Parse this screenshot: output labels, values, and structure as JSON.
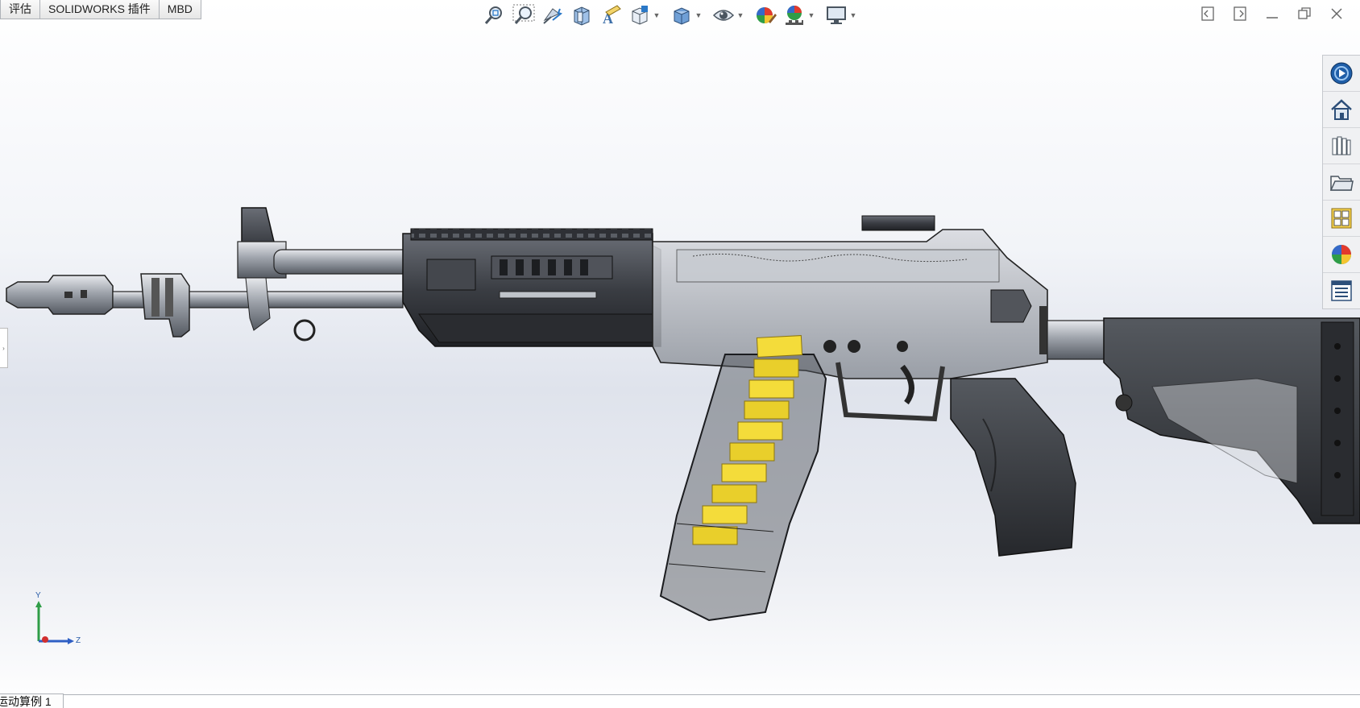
{
  "tabs": [
    {
      "label": "评估"
    },
    {
      "label": "SOLIDWORKS 插件"
    },
    {
      "label": "MBD"
    }
  ],
  "hud_icons": [
    "zoom-to-fit-icon",
    "zoom-to-area-icon",
    "previous-view-icon",
    "section-view-icon",
    "dynamic-annotation-icon",
    "view-orientation-icon",
    "display-style-icon",
    "hide-show-items-icon",
    "edit-appearance-icon",
    "apply-scene-icon",
    "view-settings-icon"
  ],
  "taskpane_icons": [
    "solidworks-resources-icon",
    "design-library-icon",
    "file-explorer-icon",
    "folder-icon",
    "view-palette-icon",
    "appearances-scenes-icon",
    "custom-properties-icon"
  ],
  "triad": {
    "y": "Y",
    "z": "Z"
  },
  "bottom_tab": {
    "label": "运动算例 1"
  },
  "colors": {
    "accent": "#f4dc3a",
    "model_dark": "#2b2d31",
    "model_mid": "#6c7078",
    "steel": "#b9bdc4"
  }
}
